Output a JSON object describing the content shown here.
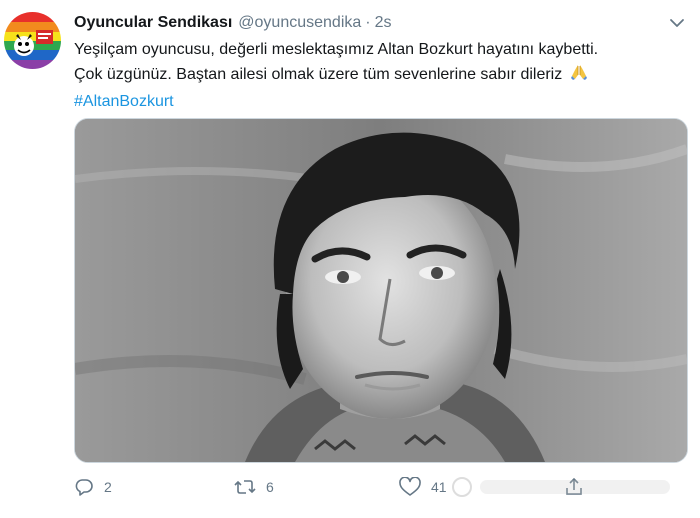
{
  "tweet": {
    "account": {
      "name": "Oyuncular Sendikası",
      "handle": "@oyuncusendika",
      "separator": "·",
      "time": "2s",
      "avatar_icon": "union-logo-rainbow-icon"
    },
    "text_line1": "Yeşilçam oyuncusu, değerli meslektaşımız Altan Bozkurt hayatını kaybetti.",
    "text_line2": "Çok üzgünüz. Baştan ailesi olmak üzere tüm sevenlerine sabır dileriz",
    "text_line2_emoji": "folded-hands-icon",
    "hashtag": "#AltanBozkurt",
    "media": {
      "type": "photo",
      "style": "black-and-white portrait"
    },
    "actions": {
      "reply_count": "2",
      "retweet_count": "6",
      "like_count": "41"
    }
  },
  "icons": {
    "more": "chevron-down-icon",
    "reply": "reply-icon",
    "retweet": "retweet-icon",
    "like": "heart-icon",
    "share": "share-icon"
  },
  "colors": {
    "text": "#14171a",
    "muted": "#657786",
    "link": "#1b95e0",
    "border": "#ccd6dd"
  }
}
